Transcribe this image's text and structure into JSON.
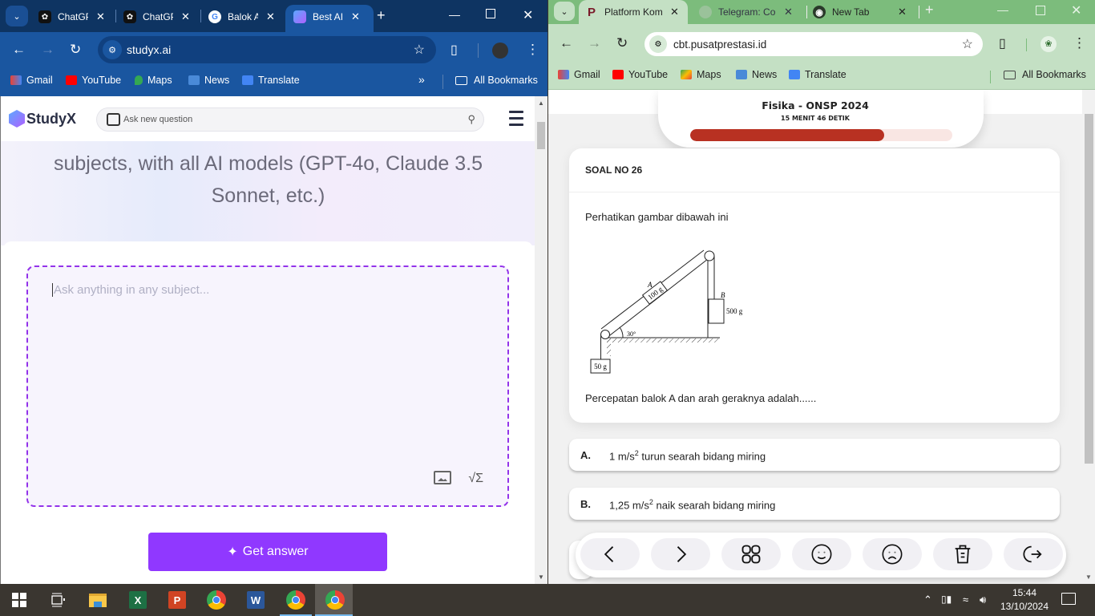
{
  "left_window": {
    "tabs": [
      {
        "title": "ChatGPT",
        "icon": "chatgpt-icon"
      },
      {
        "title": "ChatGPT",
        "icon": "chatgpt-icon"
      },
      {
        "title": "Balok A",
        "icon": "google-icon"
      },
      {
        "title": "Best AI",
        "icon": "studyx-icon",
        "active": true
      }
    ],
    "address": "studyx.ai",
    "bookmarks": [
      "Gmail",
      "YouTube",
      "Maps",
      "News",
      "Translate"
    ],
    "overflow_label": "»",
    "all_bookmarks": "All Bookmarks",
    "page": {
      "logo": "StudyX",
      "search_placeholder": "Ask new question",
      "hero_line1": "subjects, with all AI models (GPT-4o, Claude 3.5",
      "hero_line2": "Sonnet, etc.)",
      "ask_placeholder": "Ask anything in any subject...",
      "math_button": "√Σ",
      "get_answer": "Get answer"
    }
  },
  "right_window": {
    "tabs": [
      {
        "title": "Platform Kom",
        "icon": "platform-icon",
        "active": true
      },
      {
        "title": "Telegram: Co",
        "icon": "telegram-icon"
      },
      {
        "title": "New Tab",
        "icon": "chrome-icon"
      }
    ],
    "address": "cbt.pusatprestasi.id",
    "bookmarks": [
      "Gmail",
      "YouTube",
      "Maps",
      "News",
      "Translate"
    ],
    "all_bookmarks": "All Bookmarks",
    "exam": {
      "title": "Fisika - ONSP 2024",
      "timer": "15 MENIT 46 DETIK",
      "progress_percent": 74,
      "question_number": "SOAL NO 26",
      "intro": "Perhatikan gambar dibawah ini",
      "figure": {
        "block_a_label": "A",
        "block_a_mass": "100 g",
        "block_b_label": "B",
        "block_b_mass": "500 g",
        "hanging_mass": "50 g",
        "angle": "30°"
      },
      "question": "Percepatan balok A dan arah geraknya adalah......",
      "options": [
        {
          "label": "A.",
          "value": "1 m/s",
          "sup": "2",
          "rest": " turun searah bidang miring"
        },
        {
          "label": "B.",
          "value": "1,25 m/s",
          "sup": "2",
          "rest": " naik searah bidang miring"
        }
      ],
      "nav_buttons": [
        "previous",
        "next",
        "question-grid",
        "confident",
        "unsure",
        "clear-answer",
        "exit"
      ]
    }
  },
  "taskbar": {
    "apps": [
      "Start",
      "Task View",
      "File Explorer",
      "Excel",
      "PowerPoint",
      "Chrome",
      "Word",
      "Chrome",
      "Chrome"
    ],
    "time": "15:44",
    "date": "13/10/2024"
  }
}
